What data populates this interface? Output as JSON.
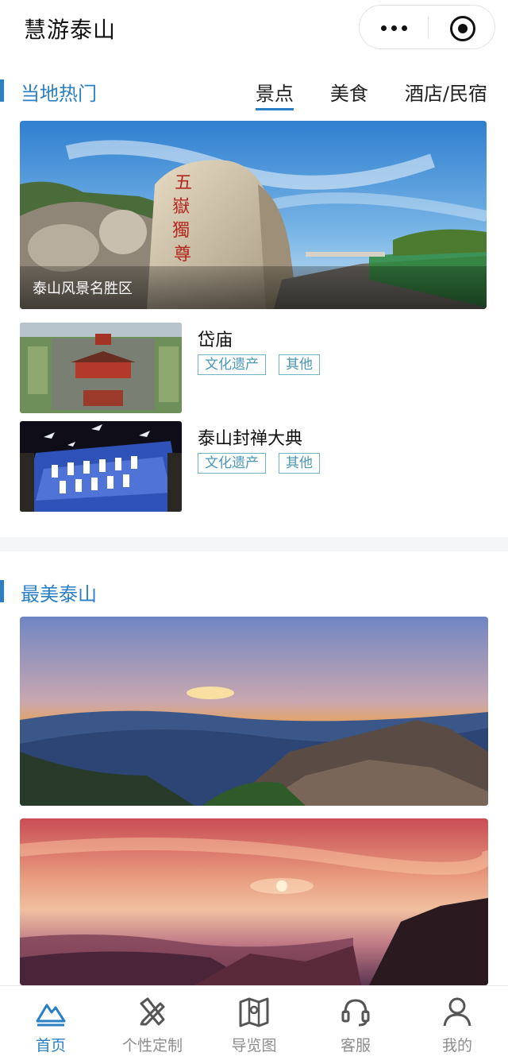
{
  "app": {
    "title": "慧游泰山"
  },
  "capsule": {
    "more_icon": "more-dots-icon",
    "close_icon": "target-icon"
  },
  "hot": {
    "title": "当地热门",
    "tabs": [
      {
        "label": "景点",
        "active": true
      },
      {
        "label": "美食",
        "active": false
      },
      {
        "label": "酒店/民宿",
        "active": false
      }
    ],
    "hero": {
      "caption": "泰山风景名胜区"
    },
    "items": [
      {
        "name": "岱庙",
        "tags": [
          "文化遗产",
          "其他"
        ]
      },
      {
        "name": "泰山封禅大典",
        "tags": [
          "文化遗产",
          "其他"
        ]
      }
    ]
  },
  "beautiful": {
    "title": "最美泰山"
  },
  "tabbar": {
    "items": [
      {
        "label": "首页",
        "icon": "mountain-icon",
        "active": true
      },
      {
        "label": "个性定制",
        "icon": "pencil-ruler-icon",
        "active": false
      },
      {
        "label": "导览图",
        "icon": "map-pin-icon",
        "active": false
      },
      {
        "label": "客服",
        "icon": "headset-icon",
        "active": false
      },
      {
        "label": "我的",
        "icon": "user-icon",
        "active": false
      }
    ]
  },
  "colors": {
    "accent": "#2a7fc6",
    "tag": "#4a97b3"
  }
}
